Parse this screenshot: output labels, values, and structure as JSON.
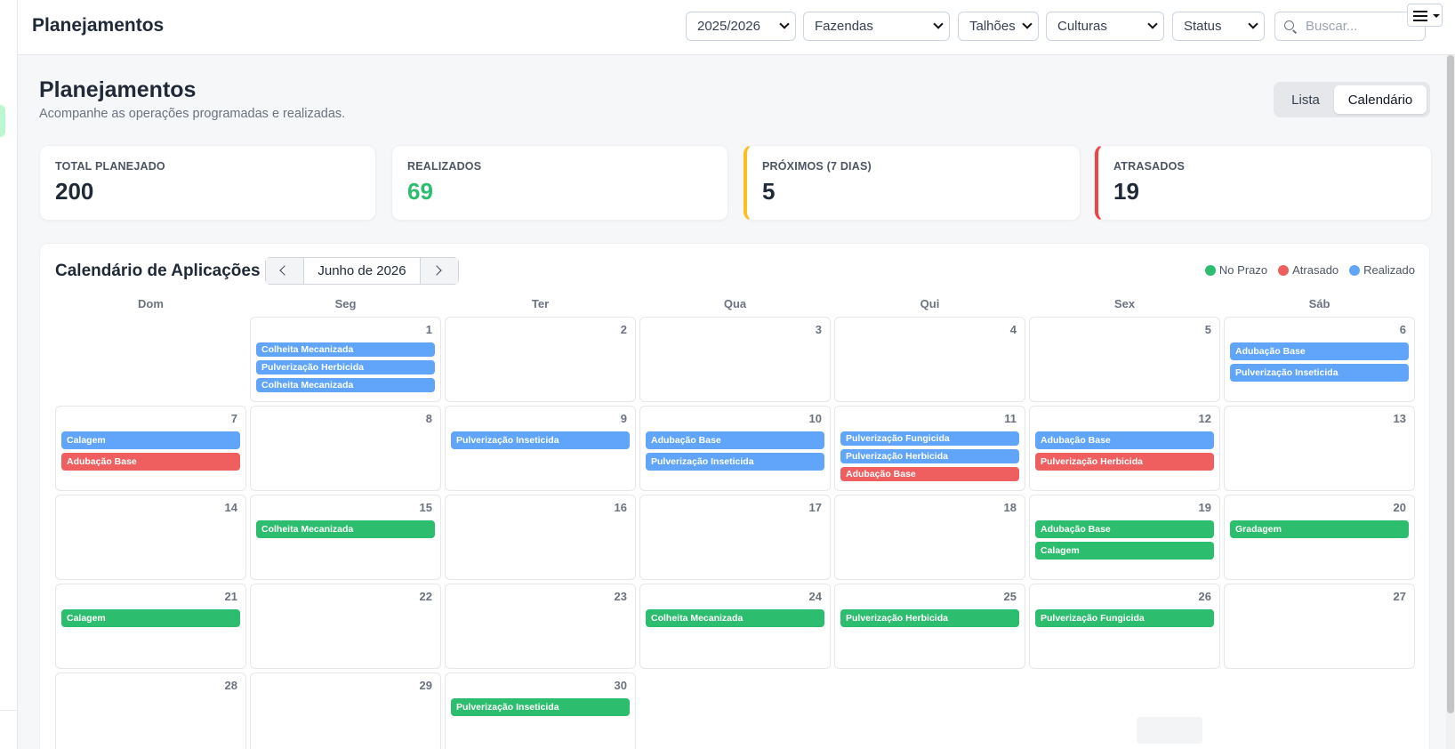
{
  "header": {
    "title": "Planejamentos",
    "filters": {
      "season": "2025/2026",
      "farms": "Fazendas",
      "plots": "Talhões",
      "crops": "Culturas",
      "status": "Status"
    },
    "search_placeholder": "Buscar...",
    "menu_icon": "hamburger-menu-icon"
  },
  "page": {
    "title": "Planejamentos",
    "subtitle": "Acompanhe as operações programadas e realizadas.",
    "view_toggle": {
      "list_label": "Lista",
      "calendar_label": "Calendário",
      "active": "Calendário"
    }
  },
  "stats": [
    {
      "label": "TOTAL PLANEJADO",
      "value": "200",
      "value_color": "#1f2937"
    },
    {
      "label": "REALIZADOS",
      "value": "69",
      "value_color": "#2dbd6e"
    },
    {
      "label": "PRÓXIMOS (7 DIAS)",
      "value": "5",
      "value_color": "#1f2937",
      "accent": "#fbbf24"
    },
    {
      "label": "ATRASADOS",
      "value": "19",
      "value_color": "#1f2937",
      "accent": "#ef4444"
    }
  ],
  "calendar": {
    "title": "Calendário de Aplicações",
    "month_label": "Junho de 2026",
    "legend": [
      {
        "label": "No Prazo",
        "color": "#2dbd6e"
      },
      {
        "label": "Atrasado",
        "color": "#ef5f5f"
      },
      {
        "label": "Realizado",
        "color": "#60a5fa"
      }
    ],
    "weekdays": [
      "Dom",
      "Seg",
      "Ter",
      "Qua",
      "Qui",
      "Sex",
      "Sáb"
    ],
    "leading_blank_days": 1,
    "days": [
      {
        "day": "1",
        "events": [
          {
            "label": "Colheita Mecanizada",
            "status": "realizado"
          },
          {
            "label": "Pulverização Herbicida",
            "status": "realizado"
          },
          {
            "label": "Colheita Mecanizada",
            "status": "realizado"
          }
        ]
      },
      {
        "day": "2",
        "events": []
      },
      {
        "day": "3",
        "events": []
      },
      {
        "day": "4",
        "events": []
      },
      {
        "day": "5",
        "events": []
      },
      {
        "day": "6",
        "events": [
          {
            "label": "Adubação Base",
            "status": "realizado"
          },
          {
            "label": "Pulverização Inseticida",
            "status": "realizado"
          }
        ]
      },
      {
        "day": "7",
        "events": [
          {
            "label": "Calagem",
            "status": "realizado"
          },
          {
            "label": "Adubação Base",
            "status": "atrasado"
          }
        ]
      },
      {
        "day": "8",
        "events": []
      },
      {
        "day": "9",
        "events": [
          {
            "label": "Pulverização Inseticida",
            "status": "realizado"
          }
        ]
      },
      {
        "day": "10",
        "events": [
          {
            "label": "Adubação Base",
            "status": "realizado"
          },
          {
            "label": "Pulverização Inseticida",
            "status": "realizado"
          }
        ]
      },
      {
        "day": "11",
        "events": [
          {
            "label": "Pulverização Fungicida",
            "status": "realizado"
          },
          {
            "label": "Pulverização Herbicida",
            "status": "realizado"
          },
          {
            "label": "Adubação Base",
            "status": "atrasado"
          }
        ]
      },
      {
        "day": "12",
        "events": [
          {
            "label": "Adubação Base",
            "status": "realizado"
          },
          {
            "label": "Pulverização Herbicida",
            "status": "atrasado"
          }
        ]
      },
      {
        "day": "13",
        "events": []
      },
      {
        "day": "14",
        "events": []
      },
      {
        "day": "15",
        "events": [
          {
            "label": "Colheita Mecanizada",
            "status": "noprazo"
          }
        ]
      },
      {
        "day": "16",
        "events": []
      },
      {
        "day": "17",
        "events": []
      },
      {
        "day": "18",
        "events": []
      },
      {
        "day": "19",
        "events": [
          {
            "label": "Adubação Base",
            "status": "noprazo"
          },
          {
            "label": "Calagem",
            "status": "noprazo"
          }
        ]
      },
      {
        "day": "20",
        "events": [
          {
            "label": "Gradagem",
            "status": "noprazo"
          }
        ]
      },
      {
        "day": "21",
        "events": [
          {
            "label": "Calagem",
            "status": "noprazo"
          }
        ]
      },
      {
        "day": "22",
        "events": []
      },
      {
        "day": "23",
        "events": []
      },
      {
        "day": "24",
        "events": [
          {
            "label": "Colheita Mecanizada",
            "status": "noprazo"
          }
        ]
      },
      {
        "day": "25",
        "events": [
          {
            "label": "Pulverização Herbicida",
            "status": "noprazo"
          }
        ]
      },
      {
        "day": "26",
        "events": [
          {
            "label": "Pulverização Fungicida",
            "status": "noprazo"
          }
        ]
      },
      {
        "day": "27",
        "events": []
      },
      {
        "day": "28",
        "events": []
      },
      {
        "day": "29",
        "events": []
      },
      {
        "day": "30",
        "events": [
          {
            "label": "Pulverização Inseticida",
            "status": "noprazo"
          }
        ]
      }
    ]
  }
}
